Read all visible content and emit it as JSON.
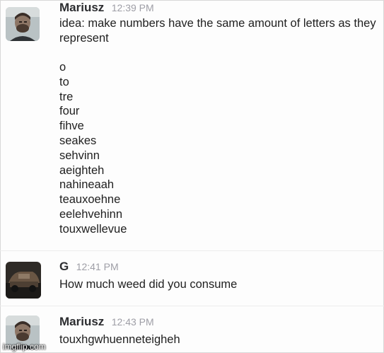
{
  "messages": [
    {
      "author": "Mariusz",
      "time": "12:39 PM",
      "text": "idea: make numbers have the same amount of letters as they represent",
      "list": [
        "o",
        "to",
        "tre",
        "four",
        "fihve",
        "seakes",
        "sehvinn",
        "aeighteh",
        "nahineaah",
        "teauxoehne",
        "eelehvehinn",
        "touxwellevue"
      ]
    },
    {
      "author": "G",
      "time": "12:41 PM",
      "text": "How much weed did you consume"
    },
    {
      "author": "Mariusz",
      "time": "12:43 PM",
      "text": "touxhgwhuenneteigheh"
    }
  ],
  "watermark": "imgflip.com"
}
